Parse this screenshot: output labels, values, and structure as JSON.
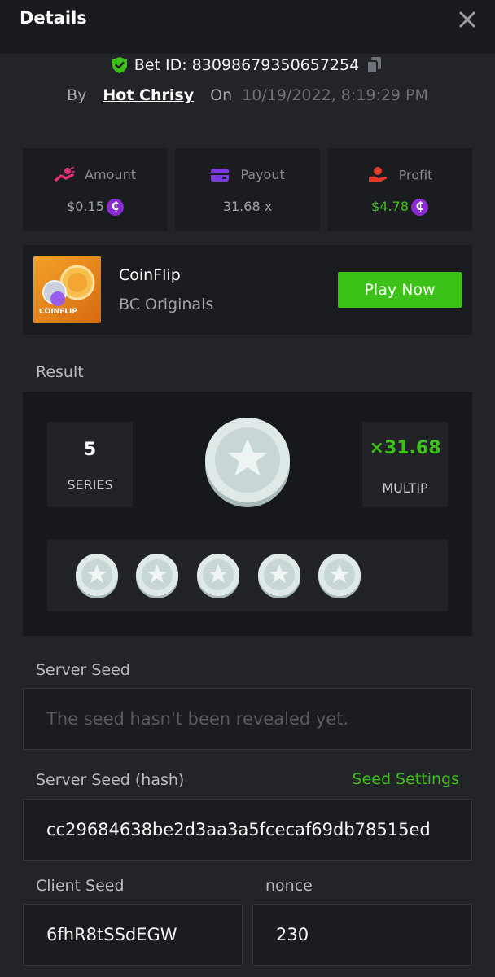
{
  "header": {
    "title": "Details",
    "close_icon": "close-icon"
  },
  "bet": {
    "id_label": "Bet ID: 830986793506572​54",
    "by_label": "By",
    "user": "Hot Chrisy",
    "on_label": "On",
    "datetime": "10/19/2022, 8:19:29 PM"
  },
  "stats": {
    "amount": {
      "label": "Amount",
      "value": "$0.15",
      "icon": "money-hand-icon"
    },
    "payout": {
      "label": "Payout",
      "value": "31.68 x",
      "icon": "wallet-icon"
    },
    "profit": {
      "label": "Profit",
      "value": "$4.78",
      "icon": "profit-hand-icon"
    },
    "currency_symbol": "₵"
  },
  "game": {
    "thumb_label": "COINFLIP",
    "name": "CoinFlip",
    "provider": "BC Originals",
    "play_label": "Play Now"
  },
  "result": {
    "label": "Result",
    "series_value": "5",
    "series_label": "SERIES",
    "multiplier_value": "×31.68",
    "multiplier_label": "MULTIP",
    "history_coins": [
      "silver",
      "silver",
      "silver",
      "silver",
      "silver"
    ]
  },
  "seeds": {
    "server_seed_label": "Server Seed",
    "server_seed_placeholder": "The seed hasn't been revealed yet.",
    "server_hash_label": "Server Seed (hash)",
    "seed_settings_label": "Seed Settings",
    "server_hash_value": "cc29684638be2d3aa3a5fcecaf69db78515ed",
    "client_seed_label": "Client Seed",
    "client_seed_value": "6fhR8tSSdEGW",
    "nonce_label": "nonce",
    "nonce_value": "230"
  },
  "colors": {
    "accent_green": "#3bc117",
    "coin_purple": "#8b2bd6",
    "bg": "#232428"
  }
}
